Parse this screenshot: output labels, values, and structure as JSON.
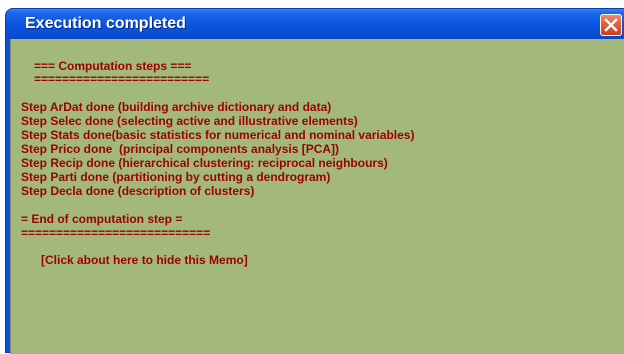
{
  "window": {
    "title": "Execution completed",
    "close_icon": "close-icon"
  },
  "memo": {
    "header": "=== Computation steps ===",
    "header_rule": "=========================",
    "steps": [
      "Step ArDat done (building archive dictionary and data)",
      "Step Selec done (selecting active and illustrative elements)",
      "Step Stats done(basic statistics for numerical and nominal variables)",
      "Step Prico done  (principal components analysis [PCA])",
      "Step Recip done (hierarchical clustering: reciprocal neighbours)",
      "Step Parti done (partitioning by cutting a dendrogram)",
      "Step Decla done (description of clusters)"
    ],
    "footer": "= End of computation step =",
    "footer_rule": "===========================",
    "hide_hint": "[Click about here to hide this Memo]"
  },
  "colors": {
    "memo_background": "#a2b97b",
    "memo_text": "#9c0000",
    "titlebar": "#0a4fd6",
    "close_button": "#e2603a"
  }
}
